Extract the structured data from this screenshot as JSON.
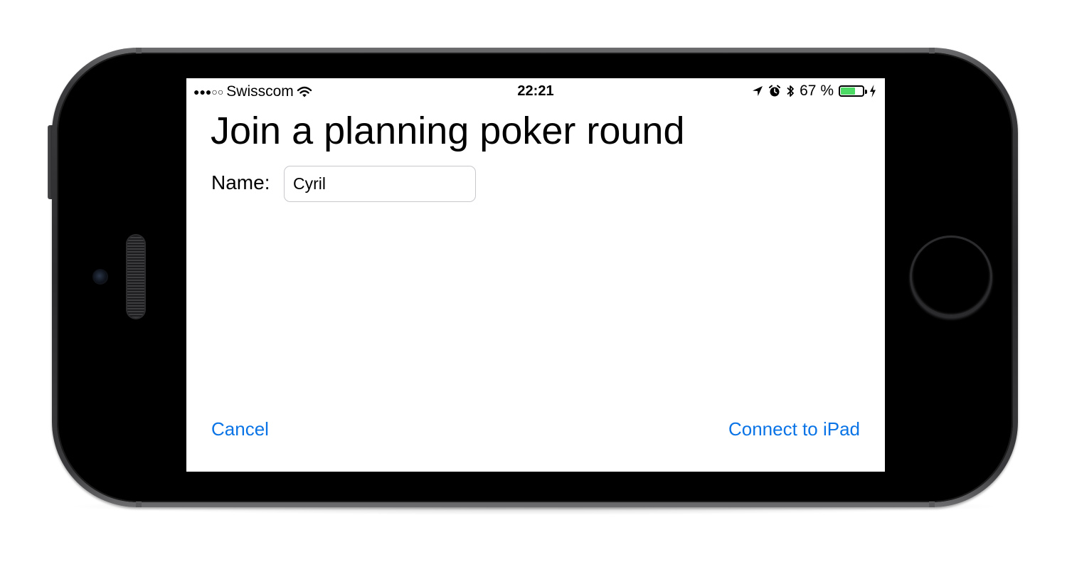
{
  "status_bar": {
    "signal": "●●●○○",
    "carrier": "Swisscom",
    "time": "22:21",
    "battery_text": "67 %",
    "battery_level": 0.67,
    "battery_color": "#4cd964",
    "icons": [
      "wifi-icon",
      "location-icon",
      "alarm-icon",
      "bluetooth-icon",
      "battery-icon",
      "charging-icon"
    ]
  },
  "page": {
    "title": "Join a planning poker round"
  },
  "form": {
    "name_label": "Name:",
    "name_value": "Cyril",
    "name_placeholder": ""
  },
  "actions": {
    "cancel_label": "Cancel",
    "connect_label": "Connect to iPad",
    "link_color": "#0a74e6"
  }
}
